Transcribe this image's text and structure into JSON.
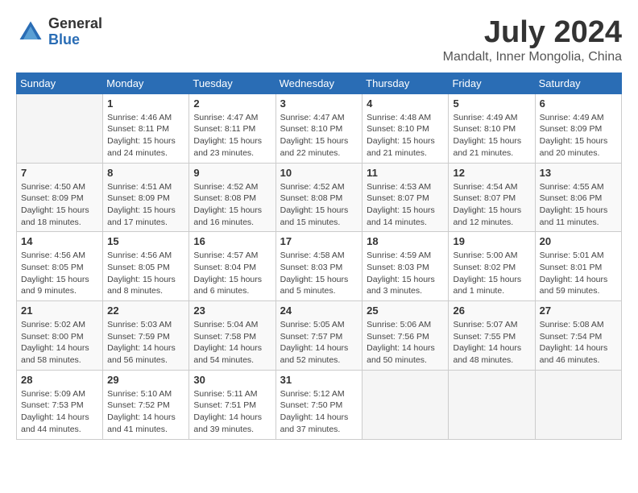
{
  "header": {
    "logo_general": "General",
    "logo_blue": "Blue",
    "month_year": "July 2024",
    "location": "Mandalt, Inner Mongolia, China"
  },
  "days_of_week": [
    "Sunday",
    "Monday",
    "Tuesday",
    "Wednesday",
    "Thursday",
    "Friday",
    "Saturday"
  ],
  "weeks": [
    [
      {
        "day": "",
        "info": ""
      },
      {
        "day": "1",
        "info": "Sunrise: 4:46 AM\nSunset: 8:11 PM\nDaylight: 15 hours\nand 24 minutes."
      },
      {
        "day": "2",
        "info": "Sunrise: 4:47 AM\nSunset: 8:11 PM\nDaylight: 15 hours\nand 23 minutes."
      },
      {
        "day": "3",
        "info": "Sunrise: 4:47 AM\nSunset: 8:10 PM\nDaylight: 15 hours\nand 22 minutes."
      },
      {
        "day": "4",
        "info": "Sunrise: 4:48 AM\nSunset: 8:10 PM\nDaylight: 15 hours\nand 21 minutes."
      },
      {
        "day": "5",
        "info": "Sunrise: 4:49 AM\nSunset: 8:10 PM\nDaylight: 15 hours\nand 21 minutes."
      },
      {
        "day": "6",
        "info": "Sunrise: 4:49 AM\nSunset: 8:09 PM\nDaylight: 15 hours\nand 20 minutes."
      }
    ],
    [
      {
        "day": "7",
        "info": "Sunrise: 4:50 AM\nSunset: 8:09 PM\nDaylight: 15 hours\nand 18 minutes."
      },
      {
        "day": "8",
        "info": "Sunrise: 4:51 AM\nSunset: 8:09 PM\nDaylight: 15 hours\nand 17 minutes."
      },
      {
        "day": "9",
        "info": "Sunrise: 4:52 AM\nSunset: 8:08 PM\nDaylight: 15 hours\nand 16 minutes."
      },
      {
        "day": "10",
        "info": "Sunrise: 4:52 AM\nSunset: 8:08 PM\nDaylight: 15 hours\nand 15 minutes."
      },
      {
        "day": "11",
        "info": "Sunrise: 4:53 AM\nSunset: 8:07 PM\nDaylight: 15 hours\nand 14 minutes."
      },
      {
        "day": "12",
        "info": "Sunrise: 4:54 AM\nSunset: 8:07 PM\nDaylight: 15 hours\nand 12 minutes."
      },
      {
        "day": "13",
        "info": "Sunrise: 4:55 AM\nSunset: 8:06 PM\nDaylight: 15 hours\nand 11 minutes."
      }
    ],
    [
      {
        "day": "14",
        "info": "Sunrise: 4:56 AM\nSunset: 8:05 PM\nDaylight: 15 hours\nand 9 minutes."
      },
      {
        "day": "15",
        "info": "Sunrise: 4:56 AM\nSunset: 8:05 PM\nDaylight: 15 hours\nand 8 minutes."
      },
      {
        "day": "16",
        "info": "Sunrise: 4:57 AM\nSunset: 8:04 PM\nDaylight: 15 hours\nand 6 minutes."
      },
      {
        "day": "17",
        "info": "Sunrise: 4:58 AM\nSunset: 8:03 PM\nDaylight: 15 hours\nand 5 minutes."
      },
      {
        "day": "18",
        "info": "Sunrise: 4:59 AM\nSunset: 8:03 PM\nDaylight: 15 hours\nand 3 minutes."
      },
      {
        "day": "19",
        "info": "Sunrise: 5:00 AM\nSunset: 8:02 PM\nDaylight: 15 hours\nand 1 minute."
      },
      {
        "day": "20",
        "info": "Sunrise: 5:01 AM\nSunset: 8:01 PM\nDaylight: 14 hours\nand 59 minutes."
      }
    ],
    [
      {
        "day": "21",
        "info": "Sunrise: 5:02 AM\nSunset: 8:00 PM\nDaylight: 14 hours\nand 58 minutes."
      },
      {
        "day": "22",
        "info": "Sunrise: 5:03 AM\nSunset: 7:59 PM\nDaylight: 14 hours\nand 56 minutes."
      },
      {
        "day": "23",
        "info": "Sunrise: 5:04 AM\nSunset: 7:58 PM\nDaylight: 14 hours\nand 54 minutes."
      },
      {
        "day": "24",
        "info": "Sunrise: 5:05 AM\nSunset: 7:57 PM\nDaylight: 14 hours\nand 52 minutes."
      },
      {
        "day": "25",
        "info": "Sunrise: 5:06 AM\nSunset: 7:56 PM\nDaylight: 14 hours\nand 50 minutes."
      },
      {
        "day": "26",
        "info": "Sunrise: 5:07 AM\nSunset: 7:55 PM\nDaylight: 14 hours\nand 48 minutes."
      },
      {
        "day": "27",
        "info": "Sunrise: 5:08 AM\nSunset: 7:54 PM\nDaylight: 14 hours\nand 46 minutes."
      }
    ],
    [
      {
        "day": "28",
        "info": "Sunrise: 5:09 AM\nSunset: 7:53 PM\nDaylight: 14 hours\nand 44 minutes."
      },
      {
        "day": "29",
        "info": "Sunrise: 5:10 AM\nSunset: 7:52 PM\nDaylight: 14 hours\nand 41 minutes."
      },
      {
        "day": "30",
        "info": "Sunrise: 5:11 AM\nSunset: 7:51 PM\nDaylight: 14 hours\nand 39 minutes."
      },
      {
        "day": "31",
        "info": "Sunrise: 5:12 AM\nSunset: 7:50 PM\nDaylight: 14 hours\nand 37 minutes."
      },
      {
        "day": "",
        "info": ""
      },
      {
        "day": "",
        "info": ""
      },
      {
        "day": "",
        "info": ""
      }
    ]
  ]
}
